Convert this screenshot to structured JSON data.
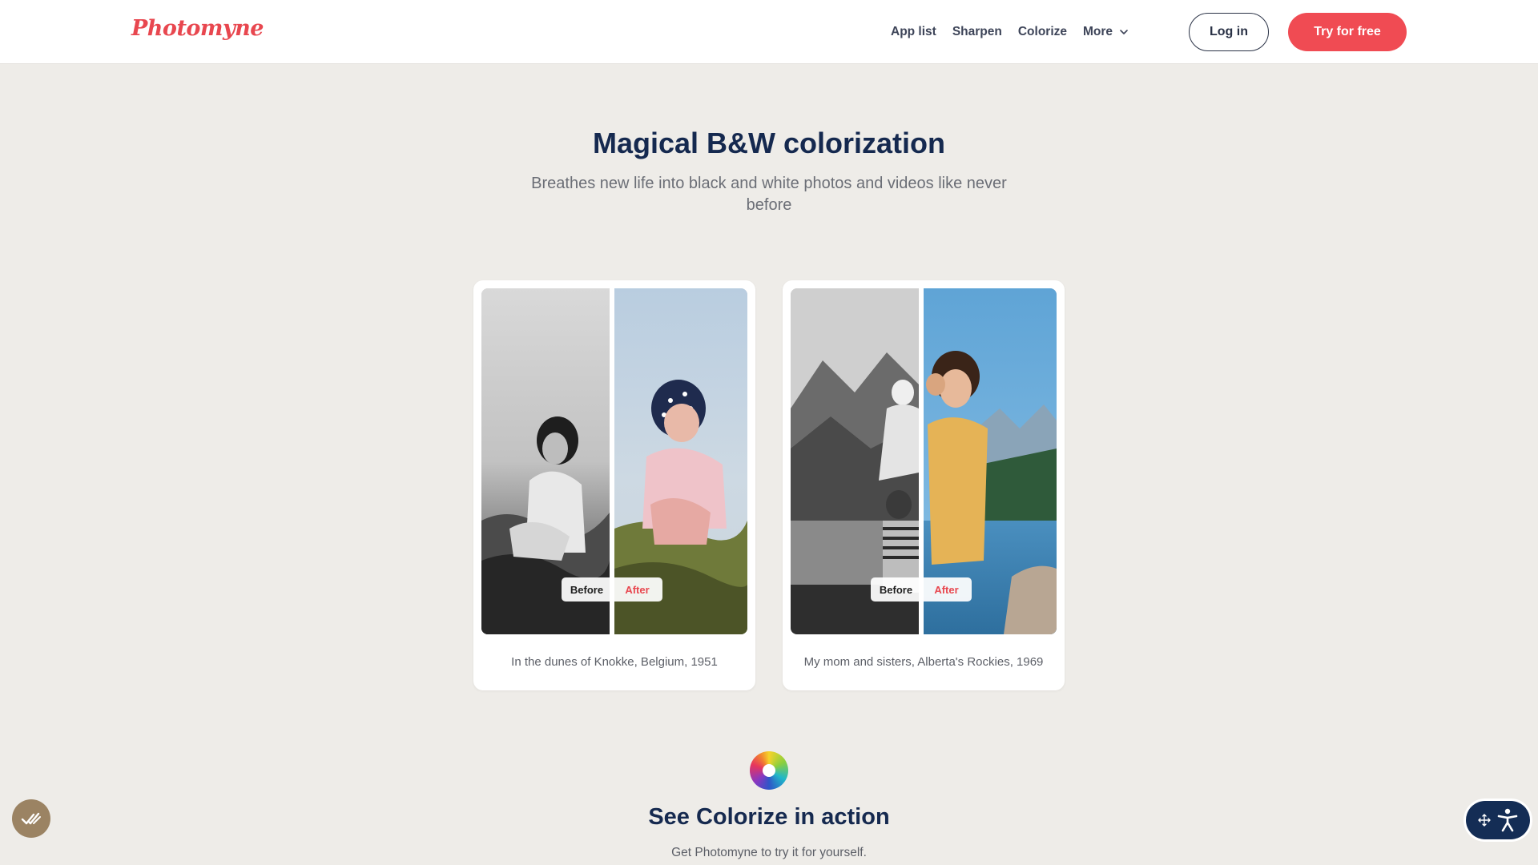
{
  "header": {
    "logo": "Photomyne",
    "nav": [
      "App list",
      "Sharpen",
      "Colorize",
      "More"
    ],
    "login_label": "Log in",
    "cta_label": "Try for free"
  },
  "hero": {
    "title": "Magical B&W colorization",
    "subtitle": "Breathes new life into black and white photos and videos like never before"
  },
  "cards": [
    {
      "before_label": "Before",
      "after_label": "After",
      "caption": "In the dunes of Knokke, Belgium, 1951"
    },
    {
      "before_label": "Before",
      "after_label": "After",
      "caption": "My mom and sisters, Alberta's Rockies, 1969"
    }
  ],
  "section": {
    "icon": "color-wheel-icon",
    "title": "See Colorize in action",
    "subtitle": "Get Photomyne to try it for yourself."
  },
  "widgets": {
    "left_icon": "double-check-icon",
    "right_icons": [
      "move-icon",
      "accessibility-icon"
    ]
  },
  "colors": {
    "brand": "#e8474f",
    "navy": "#15294f",
    "page_bg": "#eeece8"
  }
}
